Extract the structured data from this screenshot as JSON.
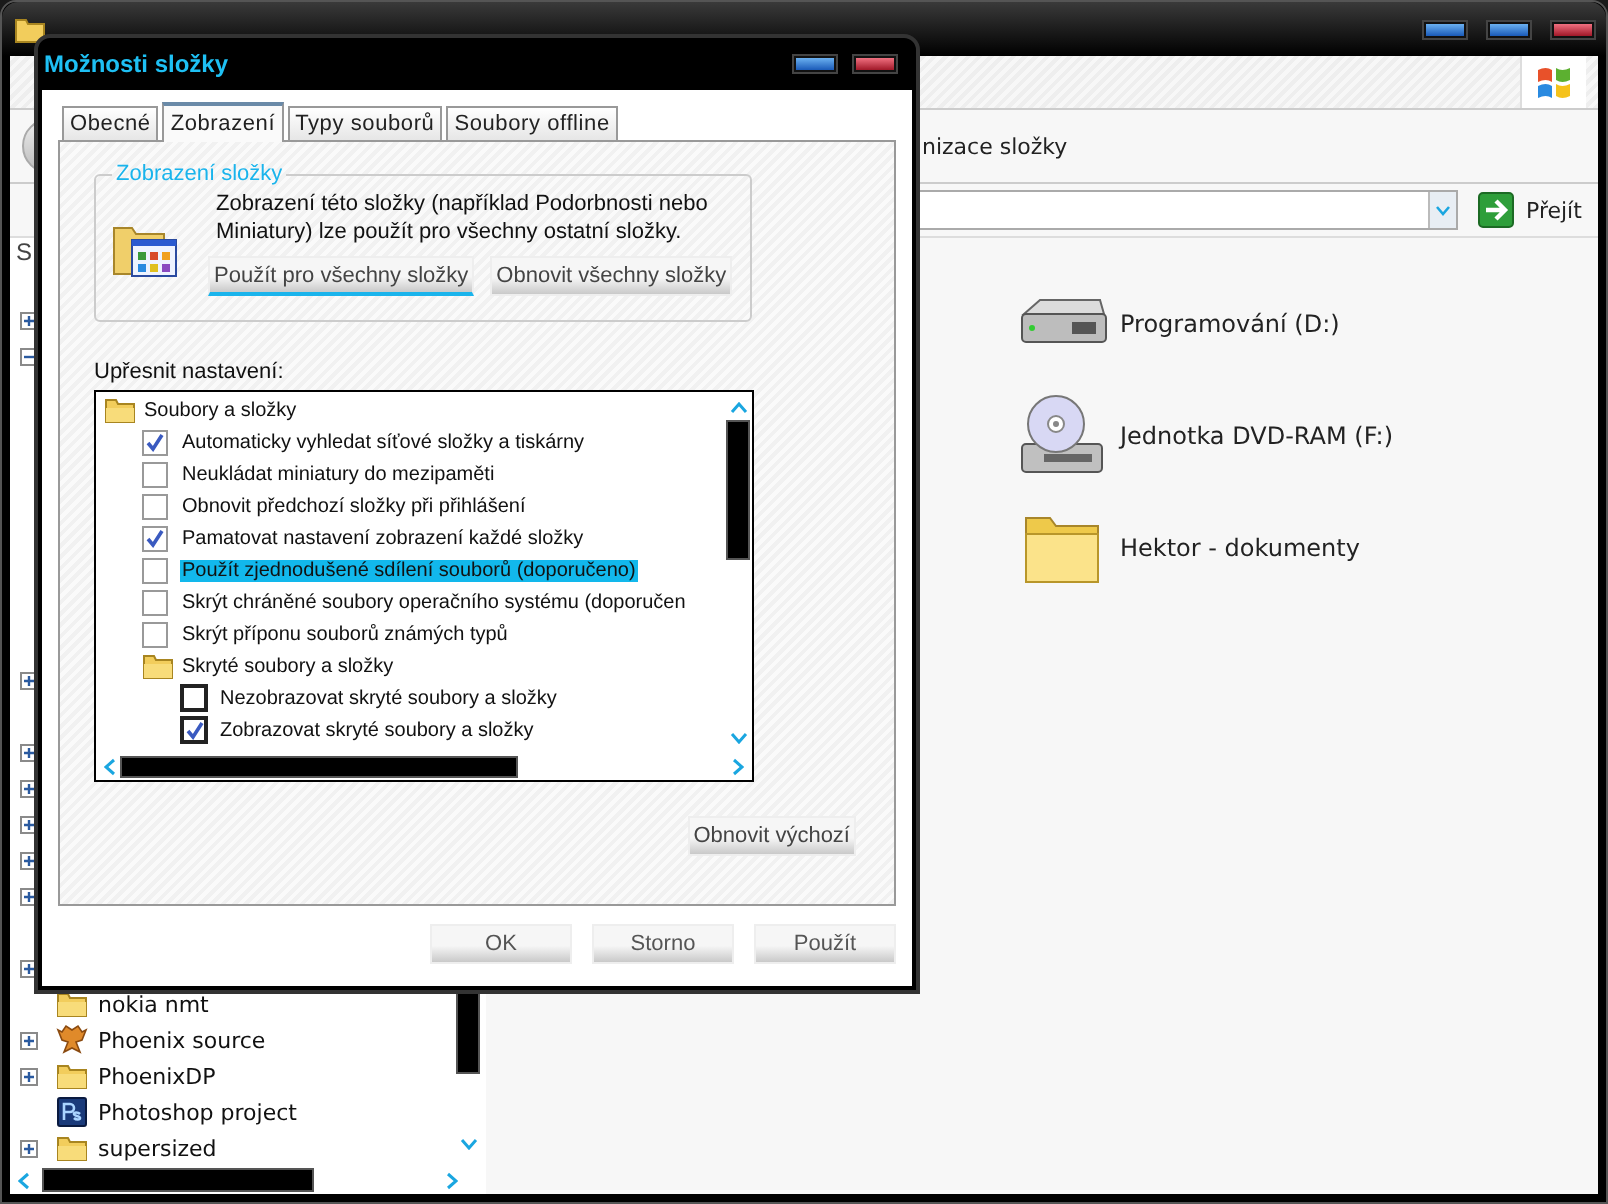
{
  "explorer": {
    "toolbar_text": "nizace složky",
    "go_button": "Přejít",
    "pane_header": "S",
    "tree": [
      {
        "kind": "computer"
      },
      {
        "kind": "hidden",
        "expanded": false
      },
      {
        "kind": "hidden",
        "expanded": true
      },
      {
        "kind": "hidden"
      },
      {
        "kind": "hidden"
      },
      {
        "kind": "hidden"
      },
      {
        "kind": "hidden"
      },
      {
        "kind": "hidden"
      },
      {
        "kind": "hidden"
      },
      {
        "kind": "hidden"
      },
      {
        "kind": "hidden"
      },
      {
        "kind": "hidden",
        "expanded": false
      },
      {
        "kind": "hidden"
      },
      {
        "kind": "hidden",
        "expanded": false
      },
      {
        "kind": "hidden",
        "expanded": false
      },
      {
        "kind": "hidden",
        "expanded": false
      },
      {
        "kind": "hidden",
        "expanded": false
      },
      {
        "kind": "hidden",
        "expanded": false
      },
      {
        "kind": "hidden"
      },
      {
        "kind": "network",
        "expanded": false
      },
      {
        "kind": "folder",
        "label": "nokia nmt"
      },
      {
        "kind": "bird",
        "expanded": false,
        "label": "Phoenix source"
      },
      {
        "kind": "folder",
        "expanded": false,
        "label": "PhoenixDP"
      },
      {
        "kind": "app",
        "label": "Photoshop project"
      },
      {
        "kind": "folder",
        "expanded": false,
        "label": "supersized"
      }
    ],
    "items": [
      {
        "kind": "hdd",
        "label": "Programování (D:)"
      },
      {
        "kind": "dvd",
        "label": "Jednotka DVD-RAM (F:)"
      },
      {
        "kind": "folder",
        "label": "Hektor - dokumenty"
      }
    ]
  },
  "dialog": {
    "title": "Možnosti složky",
    "tabs": [
      {
        "label": "Obecné",
        "selected": false
      },
      {
        "label": "Zobrazení",
        "selected": true
      },
      {
        "label": "Typy souborů",
        "selected": false
      },
      {
        "label": "Soubory offline",
        "selected": false
      }
    ],
    "group": {
      "title": "Zobrazení složky",
      "text": "Zobrazení této složky  (například Podorbnosti nebo Miniatury) lze použít pro všechny ostatní složky.",
      "buttons": [
        {
          "label": "Použít pro všechny složky",
          "focused": true
        },
        {
          "label": "Obnovit všechny složky",
          "focused": false
        }
      ]
    },
    "settings_label": "Upřesnit nastavení:",
    "settings": [
      {
        "kind": "folder",
        "label": "Soubory a složky",
        "children": [
          {
            "kind": "checkbox",
            "label": "Automaticky vyhledat síťové složky a tiskárny",
            "checked": true,
            "selected": false
          },
          {
            "kind": "checkbox",
            "label": "Neukládat miniatury do mezipaměti",
            "checked": false,
            "selected": false
          },
          {
            "kind": "checkbox",
            "label": "Obnovit předchozí složky při přihlášení",
            "checked": false,
            "selected": false
          },
          {
            "kind": "checkbox",
            "label": "Pamatovat nastavení zobrazení každé složky",
            "checked": true,
            "selected": false
          },
          {
            "kind": "checkbox",
            "label": "Použít zjednodušené sdílení souborů (doporučeno)",
            "checked": false,
            "selected": true
          },
          {
            "kind": "checkbox",
            "label": "Skrýt chráněné soubory operačního systému (doporučen",
            "checked": false,
            "selected": false
          },
          {
            "kind": "checkbox",
            "label": "Skrýt příponu souborů známých typů",
            "checked": false,
            "selected": false
          },
          {
            "kind": "folder",
            "label": "Skryté soubory a složky",
            "children": [
              {
                "kind": "radio",
                "label": "Nezobrazovat skryté soubory a složky",
                "checked": false,
                "selected": false
              },
              {
                "kind": "radio",
                "label": "Zobrazovat skryté soubory a složky",
                "checked": true,
                "selected": false
              }
            ]
          }
        ]
      }
    ],
    "restore_button": "Obnovit výchozí",
    "buttons": [
      "OK",
      "Storno",
      "Použít"
    ]
  }
}
